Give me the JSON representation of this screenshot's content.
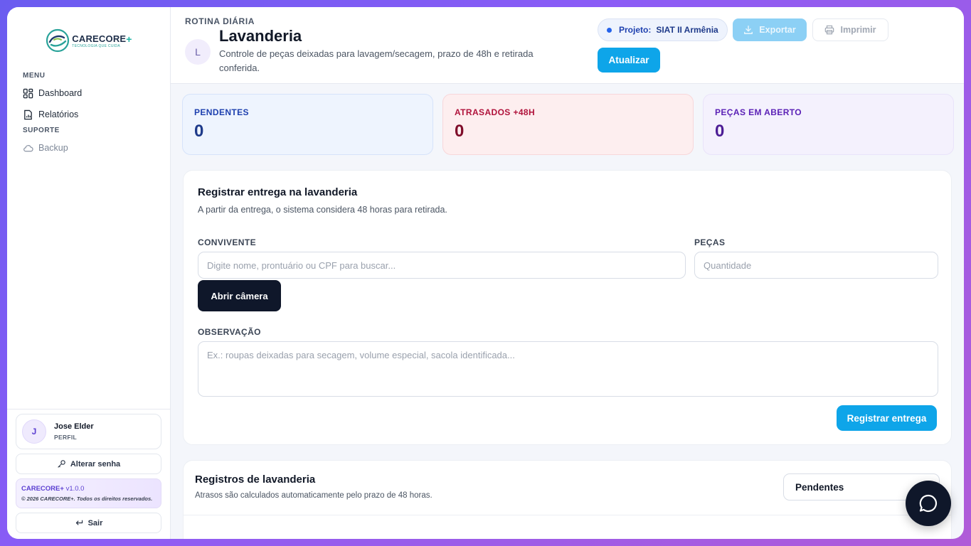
{
  "sidebar": {
    "logo": {
      "name": "CARECORE",
      "plus": "+",
      "tagline": "TECNOLOGIA QUE CUIDA"
    },
    "menu_title": "MENU",
    "menu_items": [
      {
        "label": "Dashboard",
        "icon": "dashboard-icon"
      },
      {
        "label": "Relatórios",
        "icon": "report-icon"
      }
    ],
    "support_title": "SUPORTE",
    "support_items": [
      {
        "label": "Backup",
        "icon": "cloud-icon"
      }
    ],
    "user": {
      "initial": "J",
      "name": "Jose Elder",
      "role": "PERFIL"
    },
    "change_password_label": "Alterar senha",
    "version": {
      "brand": "CARECORE+",
      "number": "v1.0.0",
      "copyright": "© 2026 CARECORE+. Todos os direitos reservados."
    },
    "logout_label": "Sair"
  },
  "header": {
    "eyebrow": "ROTINA DIÁRIA",
    "avatar_initial": "L",
    "title": "Lavanderia",
    "description": "Controle de peças deixadas para lavagem/secagem, prazo de 48h e retirada conferida.",
    "project_key": "Projeto:",
    "project_value": "SIAT II Armênia",
    "export_label": "Exportar",
    "print_label": "Imprimir",
    "refresh_label": "Atualizar"
  },
  "stats": [
    {
      "label": "PENDENTES",
      "value": "0"
    },
    {
      "label": "ATRASADOS +48H",
      "value": "0"
    },
    {
      "label": "PEÇAS EM ABERTO",
      "value": "0"
    }
  ],
  "form": {
    "title": "Registrar entrega na lavanderia",
    "subtitle": "A partir da entrega, o sistema considera 48 horas para retirada.",
    "resident_label": "CONVIVENTE",
    "resident_placeholder": "Digite nome, prontuário ou CPF para buscar...",
    "pieces_label": "PEÇAS",
    "pieces_placeholder": "Quantidade",
    "camera_label": "Abrir câmera",
    "note_label": "OBSERVAÇÃO",
    "note_placeholder": "Ex.: roupas deixadas para secagem, volume especial, sacola identificada...",
    "submit_label": "Registrar entrega"
  },
  "records": {
    "title": "Registros de lavanderia",
    "subtitle": "Atrasos são calculados automaticamente pelo prazo de 48 horas.",
    "filter_value": "Pendentes"
  },
  "colors": {
    "primary": "#0ea5e9",
    "dark": "#0f172a",
    "accent_purple": "#5b3fd1"
  }
}
